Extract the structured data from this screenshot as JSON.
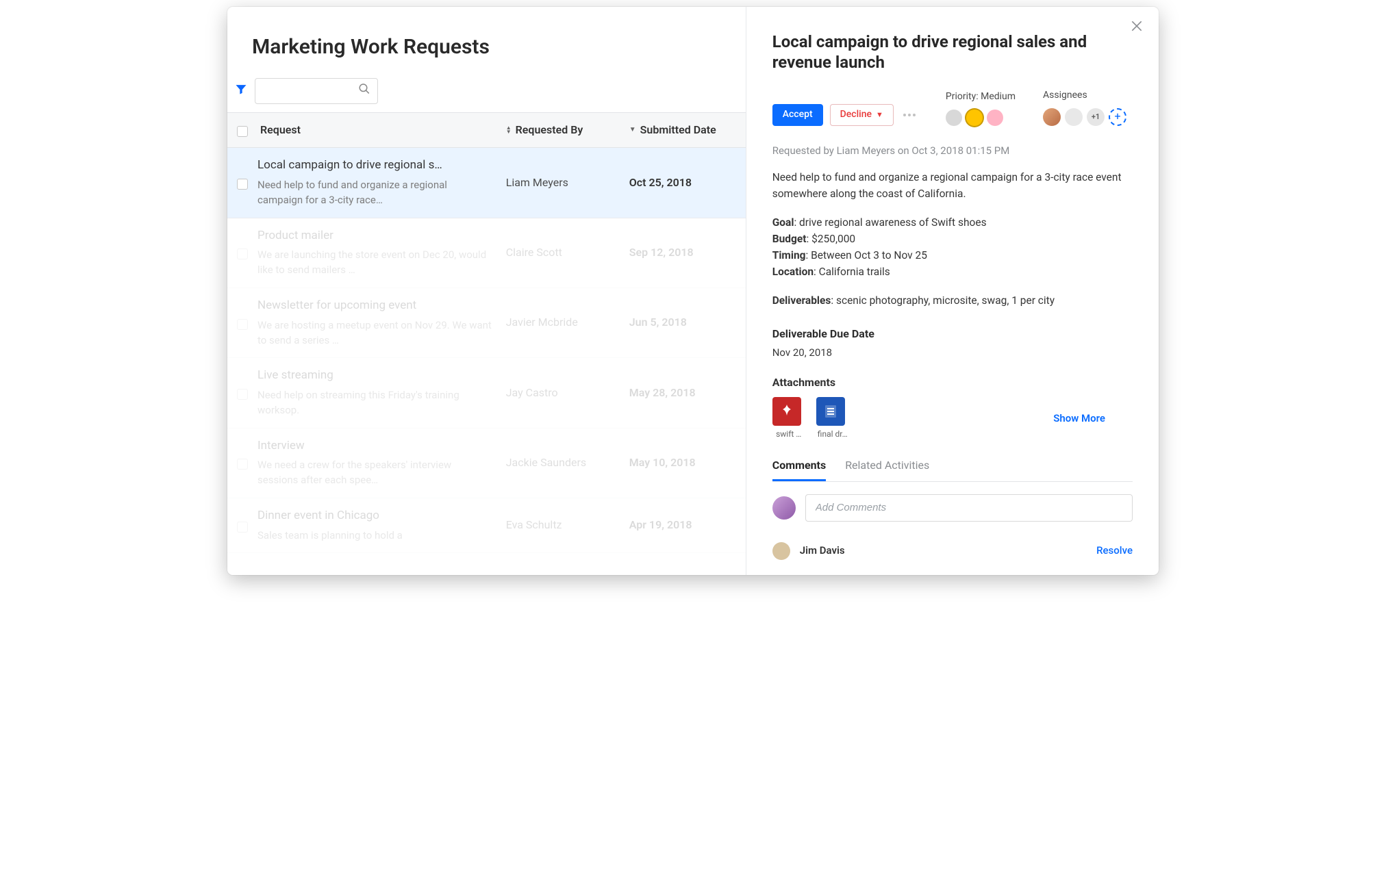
{
  "page": {
    "title": "Marketing Work Requests"
  },
  "search": {
    "placeholder": ""
  },
  "columns": {
    "request": "Request",
    "requested_by": "Requested By",
    "submitted_date": "Submitted Date"
  },
  "requests": [
    {
      "title": "Local campaign to drive regional s…",
      "desc": "Need help to fund and organize a regional campaign for a 3-city race…",
      "by": "Liam Meyers",
      "date": "Oct 25, 2018"
    },
    {
      "title": "Product mailer",
      "desc": "We are launching the store event on Dec 20, would like to send mailers …",
      "by": "Claire Scott",
      "date": "Sep 12, 2018"
    },
    {
      "title": "Newsletter for upcoming event",
      "desc": "We are hosting a meetup event on Nov 29. We want to send a series  …",
      "by": "Javier Mcbride",
      "date": "Jun 5, 2018"
    },
    {
      "title": "Live streaming",
      "desc": "Need help on streaming this Friday's training worksop.",
      "by": "Jay Castro",
      "date": "May 28, 2018"
    },
    {
      "title": "Interview",
      "desc": "We need a crew for the speakers' interview sessions after each spee…",
      "by": "Jackie Saunders",
      "date": "May 10, 2018"
    },
    {
      "title": "Dinner event in Chicago",
      "desc": "Sales team is planning to hold a",
      "by": "Eva Schultz",
      "date": "Apr 19, 2018"
    }
  ],
  "detail": {
    "title": "Local campaign to drive regional sales and revenue launch",
    "accept_label": "Accept",
    "decline_label": "Decline",
    "priority_label": "Priority: Medium",
    "assignees_label": "Assignees",
    "assignee_overflow": "+1",
    "requested_meta": "Requested by Liam Meyers on Oct 3, 2018 01:15 PM",
    "body_intro": "Need help to fund and organize a regional campaign for a 3-city race event somewhere along the coast of California.",
    "goal_label": "Goal",
    "goal": ": drive regional awareness of Swift shoes",
    "budget_label": "Budget",
    "budget": ": $250,000",
    "timing_label": "Timing",
    "timing": ": Between Oct 3 to Nov 25",
    "location_label": "Location",
    "location": ": California trails",
    "deliverables_label": "Deliverables",
    "deliverables": ": scenic photography, microsite, swag, 1 per city",
    "due_label": "Deliverable Due Date",
    "due_value": "Nov 20, 2018",
    "attachments_label": "Attachments",
    "attachments": [
      {
        "name": "swift …",
        "type": "pdf"
      },
      {
        "name": "final dr…",
        "type": "word"
      }
    ],
    "show_more": "Show More",
    "tabs": {
      "comments": "Comments",
      "related": "Related Activities"
    },
    "comment_placeholder": "Add Comments",
    "thread": {
      "author": "Jim Davis",
      "resolve": "Resolve"
    }
  }
}
